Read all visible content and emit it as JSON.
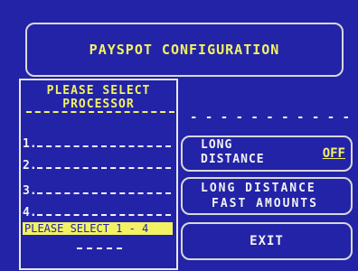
{
  "header": {
    "title": "PAYSPOT CONFIGURATION"
  },
  "options": {
    "long_distance": {
      "line1": "LONG",
      "line2": "DISTANCE",
      "state": "OFF"
    },
    "fast_amounts": {
      "line1": "LONG DISTANCE",
      "line2": "FAST AMOUNTS"
    },
    "exit": {
      "label": "EXIT"
    }
  },
  "dialog": {
    "title_line1": "PLEASE SELECT",
    "title_line2": "PROCESSOR",
    "fields": [
      "1.",
      "2.",
      "3.",
      "4."
    ],
    "prompt": "PLEASE SELECT 1 - 4"
  }
}
